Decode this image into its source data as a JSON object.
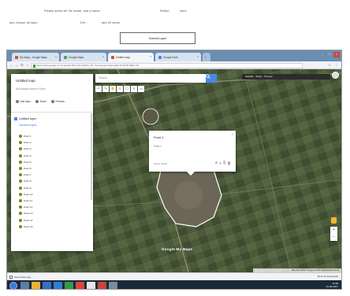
{
  "document": {
    "line1_left": "Please select all the areas, and a name : ",
    "line1_mid": "Select : ",
    "line1_right": "ones",
    "line2_left": "and choose all layer",
    "line2_mid": "Dirt  -",
    "line2_right": "and fill name:",
    "submit_label": "Submit Layer"
  },
  "browser": {
    "tabs": [
      {
        "label": "My Maps - Google Maps",
        "active": false
      },
      {
        "label": "Google Maps",
        "active": false
      },
      {
        "label": "Untitled map",
        "active": true
      },
      {
        "label": "Google Earth",
        "active": false
      }
    ],
    "new_tab_label": "+",
    "window_controls": [
      "–",
      "□",
      "×"
    ],
    "url": "https://www.google.com/maps/d/edit?mid=1xP3Ab_Sb...hl=en&usp=sharing&ll=26.84,80.95&z=15",
    "nav": {
      "back": "←",
      "forward": "→",
      "reload": "↻",
      "home": "⌂",
      "menu": "⋮",
      "star": "☆"
    }
  },
  "map": {
    "search_placeholder": "Search",
    "search_icon": "search-icon",
    "tools": [
      "↶",
      "↷",
      "✋",
      "⊙",
      "⬡",
      "⚟",
      "▭"
    ],
    "top_right_text": "Satellite  · Share  · Preview",
    "panel": {
      "title": "Untitled map",
      "subtitle": "All changes saved in Drive",
      "actions": [
        "Add layer",
        "Share",
        "Preview"
      ],
      "layer_title": "Untitled layer",
      "layer_style": "Individual styles",
      "items": [
        "Point 1",
        "Point 2",
        "Point 3",
        "Point 4",
        "Point 5",
        "Point 6",
        "Point 7",
        "Point 8",
        "Point 9",
        "Point 10",
        "Point 11",
        "Point 12",
        "Point 13",
        "Point 14",
        "Point 15"
      ],
      "menu": "⋮"
    },
    "infocard": {
      "title": "Point 1",
      "subtitle": "Point 1",
      "footer": "26.84, 80.95",
      "close": "×",
      "icons": [
        "⛭",
        "✎",
        "⎘",
        "🗑"
      ]
    },
    "zoom_in": "+",
    "zoom_out": "−",
    "logo": "Google My Maps",
    "footer": "Map data ©2017 Imagery ©2017 DigitalGlobe  Terms"
  },
  "download_bar": {
    "item": "Screenshot.png",
    "right": "Show all downloads"
  },
  "taskbar": {
    "time": "12:38",
    "date": "01-06-2017"
  },
  "colors": {
    "search_button": "#4a86e8",
    "tab_bar": "#6b8eb3",
    "taskbar": "#1b2a38",
    "map_base": "#3f4d33"
  }
}
